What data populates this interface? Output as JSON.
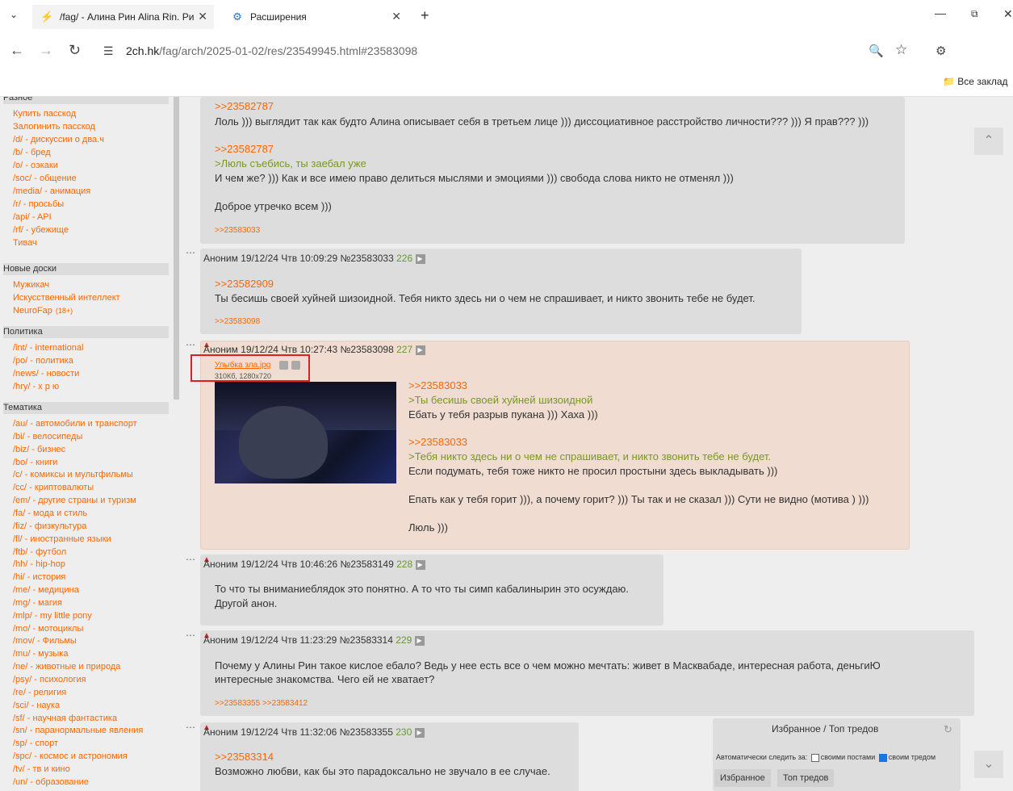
{
  "browser": {
    "tabs": [
      {
        "title": "/fag/ - Алина Рин Alina Rin. Ри",
        "icon": "bolt-icon"
      },
      {
        "title": "Расширения",
        "icon": "puzzle-icon"
      }
    ],
    "url_host": "2ch.hk",
    "url_path": "/fag/arch/2025-01-02/res/23549945.html#23583098",
    "bookmarks_folder": "Все заклад"
  },
  "sidebar": {
    "sections": [
      {
        "title": "Разное",
        "links": [
          "Купить пасскод",
          "Залогинить пасскод",
          "/d/ - дискуссии о два.ч",
          "/b/ - бред",
          "/o/ - оэкаки",
          "/soc/ - общение",
          "/media/ - анимация",
          "/r/ - просьбы",
          "/api/ - API",
          "/rf/ - убежище",
          "Тивач"
        ]
      },
      {
        "title": "Новые доски",
        "links": [
          "Мужикач",
          "Искусственный интеллект",
          "NeuroFap"
        ],
        "neurofap_badge": "(18+)"
      },
      {
        "title": "Политика",
        "links": [
          "/int/ - international",
          "/po/ - политика",
          "/news/ - новости",
          "/hry/ - х р ю"
        ]
      },
      {
        "title": "Тематика",
        "links": [
          "/au/ - автомобили и транспорт",
          "/bi/ - велосипеды",
          "/biz/ - бизнес",
          "/bo/ - книги",
          "/c/ - комиксы и мультфильмы",
          "/cc/ - криптовалюты",
          "/em/ - другие страны и туризм",
          "/fa/ - мода и стиль",
          "/fiz/ - физкультура",
          "/fl/ - иностранные языки",
          "/ftb/ - футбол",
          "/hh/ - hip-hop",
          "/hi/ - история",
          "/me/ - медицина",
          "/mg/ - магия",
          "/mlp/ - my little pony",
          "/mo/ - мотоциклы",
          "/mov/ - Фильмы",
          "/mu/ - музыка",
          "/ne/ - животные и природа",
          "/psy/ - психология",
          "/re/ - религия",
          "/sci/ - наука",
          "/sf/ - научная фантастика",
          "/sn/ - паранормальные явления",
          "/sp/ - спорт",
          "/spc/ - космос и астрономия",
          "/tv/ - тв и кино",
          "/un/ - образование"
        ]
      }
    ]
  },
  "posts": {
    "p0": {
      "top_ref": ">>23582787",
      "line1": "Лоль ))) выглядит так как будто Алина описывает себя в третьем лице ))) диссоциативное расстройство личности??? ))) Я прав??? )))",
      "ref2": ">>23582787",
      "quote2": ">Люль съебись, ты заебал уже",
      "line2": "И чем же? ))) Как и все имею право делиться мыслями и эмоциями ))) свобода слова никто не отменял )))",
      "line3": "Доброе утречко всем )))",
      "replies": ">>23583033"
    },
    "p1": {
      "header": "Аноним 19/12/24 Чтв 10:09:29 №23583033",
      "num": "226",
      "ref": ">>23582909",
      "text": "Ты бесишь своей хуйней шизоидной. Тебя никто здесь ни о чем не спрашивает, и никто звонить тебе не будет.",
      "replies": ">>23583098"
    },
    "p2": {
      "header": "Аноним 19/12/24 Чтв 10:27:43 №23583098",
      "num": "227",
      "file_name": "Улыбка зла.jpg",
      "file_meta": "310Кб, 1280x720",
      "ref1": ">>23583033",
      "quote1": ">Ты бесишь своей хуйней шизоидной",
      "text1": "Ебать у тебя разрыв пукана ))) Хаха )))",
      "ref2": ">>23583033",
      "quote2": ">Тебя никто здесь ни о чем не спрашивает, и никто звонить тебе не будет.",
      "text2": "Если подумать, тебя тоже никто не просил простыни здесь выкладывать )))",
      "text3": "Епать как у тебя горит ))), а почему горит? ))) Ты так и не сказал ))) Сути не видно (мотива ) )))",
      "text4": "Люль )))"
    },
    "p3": {
      "header": "Аноним 19/12/24 Чтв 10:46:26 №23583149",
      "num": "228",
      "text1": "То что ты вниманиеблядок это понятно. А то что ты симп кабалинырин это осуждаю.",
      "text2": "Другой анон."
    },
    "p4": {
      "header": "Аноним 19/12/24 Чтв 11:23:29 №23583314",
      "num": "229",
      "text1": "Почему у Алины Рин такое кислое ебало? Ведь у нее есть все о чем можно мечтать: живет в Масквабаде, интересная работа, деньгиЮ",
      "text2": "интересные знакомства. Чего ей не хватает?",
      "replies": ">>23583355 >>23583412"
    },
    "p5": {
      "header": "Аноним 19/12/24 Чтв 11:32:06 №23583355",
      "num": "230",
      "ref": ">>23583314",
      "text": "Возможно любви, как бы это парадоксально не звучало в ее случае."
    }
  },
  "favorites": {
    "title": "Избранное / Топ тредов",
    "auto_label": "Автоматически следить за:",
    "own_posts": "своими постами",
    "own_thread": "своим тредом",
    "own_posts_checked": false,
    "own_thread_checked": true,
    "tab_fav": "Избранное",
    "tab_top": "Топ тредов"
  }
}
